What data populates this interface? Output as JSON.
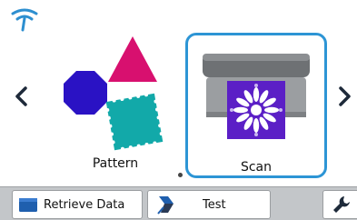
{
  "screen": {
    "tiles": [
      {
        "label": "Pattern",
        "icon": "shapes-icon",
        "selected": false
      },
      {
        "label": "Scan",
        "icon": "scanner-icon",
        "selected": true
      }
    ],
    "nav": {
      "prev_icon": "chevron-left-icon",
      "next_icon": "chevron-right-icon"
    },
    "status": {
      "wifi_icon": "wifi-icon"
    }
  },
  "toolbar": {
    "retrieve_label": "Retrieve Data",
    "test_label": "Test",
    "retrieve_icon": "folder-icon",
    "test_icon": "cutting-blade-icon",
    "settings_icon": "wrench-icon"
  },
  "colors": {
    "selection_border": "#2d95d5",
    "octagon": "#2a12c4",
    "triangle": "#d8106f",
    "stamp": "#12a9a9",
    "scan_sheet": "#5b1fc6",
    "toolbar_bg": "#c3c6c9",
    "folder": "#1f5fae"
  }
}
